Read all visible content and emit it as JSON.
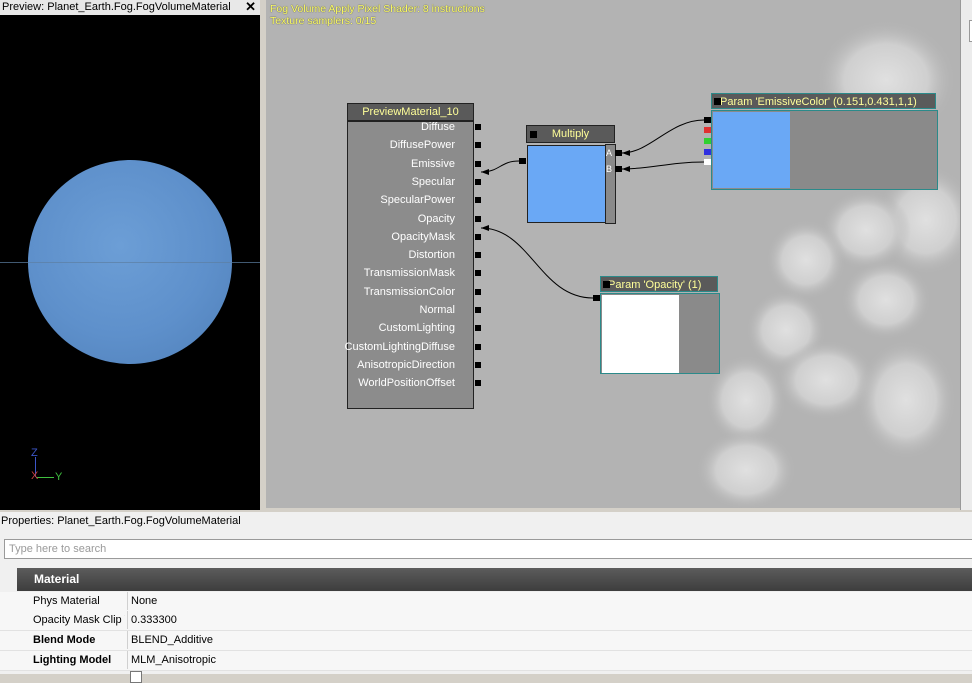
{
  "preview": {
    "title": "Preview: Planet_Earth.Fog.FogVolumeMaterial",
    "close_label": "✕",
    "axes": {
      "z": "Z",
      "x": "X",
      "y": "Y"
    }
  },
  "graph": {
    "shader_info": [
      "Fog Volume Apply Pixel Shader: 8 instructions",
      "Texture samplers: 0/15"
    ],
    "main_node": {
      "title": "PreviewMaterial_10",
      "inputs": [
        "Diffuse",
        "DiffusePower",
        "Emissive",
        "Specular",
        "SpecularPower",
        "Opacity",
        "OpacityMask",
        "Distortion",
        "TransmissionMask",
        "TransmissionColor",
        "Normal",
        "CustomLighting",
        "CustomLightingDiffuse",
        "AnisotropicDirection",
        "WorldPositionOffset"
      ]
    },
    "multiply_node": {
      "title": "Multiply",
      "input_a": "A",
      "input_b": "B",
      "preview_color": "#6aa8f5"
    },
    "emissive_param": {
      "title": "Param 'EmissiveColor' (0.151,0.431,1,1)",
      "preview_color": "#6aa8f5",
      "channel_colors": [
        "#000000",
        "#e03030",
        "#30d030",
        "#3030e0",
        "#ffffff"
      ]
    },
    "opacity_param": {
      "title": "Param 'Opacity' (1)",
      "preview_color": "#ffffff"
    }
  },
  "properties": {
    "title": "Properties: Planet_Earth.Fog.FogVolumeMaterial",
    "search_placeholder": "Type here to search",
    "category": "Material",
    "rows": [
      {
        "name": "Phys Material",
        "value": "None",
        "bold": false
      },
      {
        "name": "Opacity Mask Clip V",
        "value": "0.333300",
        "bold": false
      },
      {
        "name": "Blend Mode",
        "value": "BLEND_Additive",
        "bold": true
      },
      {
        "name": "Lighting Model",
        "value": "MLM_Anisotropic",
        "bold": true
      }
    ]
  }
}
